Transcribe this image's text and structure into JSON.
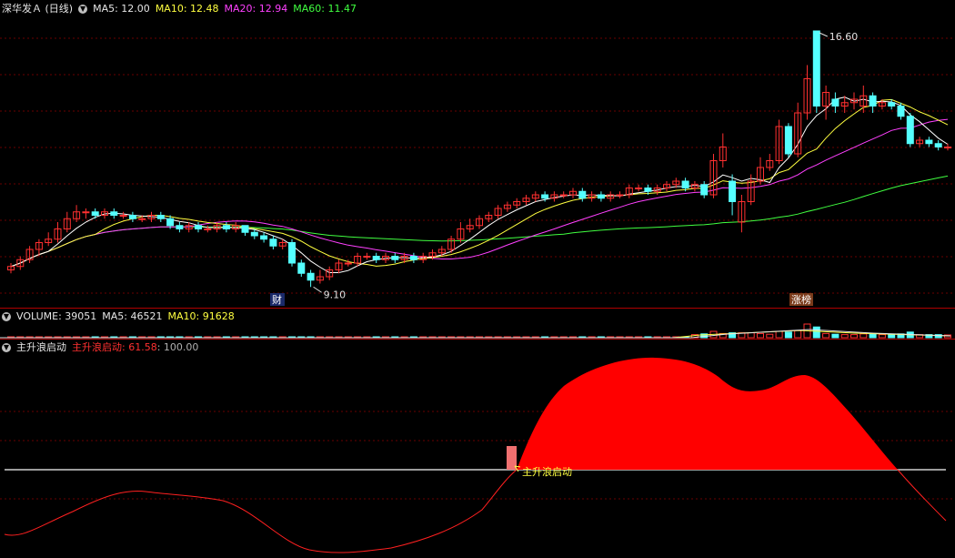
{
  "header": {
    "stock": "深华发Ａ (日线)",
    "ma5": "MA5: 12.00",
    "ma10": "MA10: 12.48",
    "ma20": "MA20: 12.94",
    "ma60": "MA60: 11.47"
  },
  "volume_header": {
    "title": "VOLUME: 39051",
    "ma5": "MA5: 46521",
    "ma10": "MA10: 91628"
  },
  "indicator_header": {
    "title": "主升浪启动",
    "value": "主升浪启动: 61.58",
    "level": ": 100.00"
  },
  "annotations": {
    "high": "16.60",
    "low": "9.10",
    "cai_badge": "财",
    "zhangbang_badge": "涨榜",
    "signal_label": "主升浪启动"
  },
  "colors": {
    "up": "#ff3030",
    "down": "#54ffff",
    "ma5": "#ffffff",
    "ma10": "#ffff40",
    "ma20": "#ff40ff",
    "ma60": "#40ff40",
    "indicator_fill": "#ff0000"
  },
  "chart_data": {
    "type": "candlestick",
    "candles": [
      {
        "o": 9.6,
        "c": 9.7,
        "h": 9.8,
        "l": 9.5
      },
      {
        "o": 9.7,
        "c": 9.9,
        "h": 10.0,
        "l": 9.6
      },
      {
        "o": 9.9,
        "c": 10.2,
        "h": 10.3,
        "l": 9.8
      },
      {
        "o": 10.2,
        "c": 10.4,
        "h": 10.5,
        "l": 10.0
      },
      {
        "o": 10.4,
        "c": 10.5,
        "h": 10.7,
        "l": 10.3
      },
      {
        "o": 10.5,
        "c": 10.8,
        "h": 11.0,
        "l": 10.4
      },
      {
        "o": 10.8,
        "c": 11.1,
        "h": 11.3,
        "l": 10.7
      },
      {
        "o": 11.1,
        "c": 11.3,
        "h": 11.5,
        "l": 11.0
      },
      {
        "o": 11.3,
        "c": 11.3,
        "h": 11.4,
        "l": 11.1
      },
      {
        "o": 11.3,
        "c": 11.2,
        "h": 11.4,
        "l": 11.1
      },
      {
        "o": 11.2,
        "c": 11.3,
        "h": 11.4,
        "l": 11.1
      },
      {
        "o": 11.3,
        "c": 11.2,
        "h": 11.4,
        "l": 11.1
      },
      {
        "o": 11.2,
        "c": 11.2,
        "h": 11.3,
        "l": 11.1
      },
      {
        "o": 11.2,
        "c": 11.1,
        "h": 11.3,
        "l": 11.0
      },
      {
        "o": 11.1,
        "c": 11.1,
        "h": 11.2,
        "l": 11.0
      },
      {
        "o": 11.1,
        "c": 11.2,
        "h": 11.3,
        "l": 11.0
      },
      {
        "o": 11.2,
        "c": 11.1,
        "h": 11.3,
        "l": 11.0
      },
      {
        "o": 11.1,
        "c": 10.9,
        "h": 11.2,
        "l": 10.8
      },
      {
        "o": 10.9,
        "c": 10.8,
        "h": 11.0,
        "l": 10.7
      },
      {
        "o": 10.8,
        "c": 10.9,
        "h": 11.0,
        "l": 10.7
      },
      {
        "o": 10.9,
        "c": 10.8,
        "h": 11.0,
        "l": 10.7
      },
      {
        "o": 10.8,
        "c": 10.8,
        "h": 10.9,
        "l": 10.7
      },
      {
        "o": 10.8,
        "c": 10.9,
        "h": 11.0,
        "l": 10.7
      },
      {
        "o": 10.9,
        "c": 10.8,
        "h": 11.0,
        "l": 10.7
      },
      {
        "o": 10.8,
        "c": 10.9,
        "h": 11.0,
        "l": 10.7
      },
      {
        "o": 10.9,
        "c": 10.7,
        "h": 10.9,
        "l": 10.6
      },
      {
        "o": 10.7,
        "c": 10.6,
        "h": 10.8,
        "l": 10.5
      },
      {
        "o": 10.6,
        "c": 10.5,
        "h": 10.7,
        "l": 10.4
      },
      {
        "o": 10.5,
        "c": 10.3,
        "h": 10.6,
        "l": 10.2
      },
      {
        "o": 10.3,
        "c": 10.4,
        "h": 10.5,
        "l": 10.2
      },
      {
        "o": 10.4,
        "c": 9.8,
        "h": 10.5,
        "l": 9.7
      },
      {
        "o": 9.8,
        "c": 9.5,
        "h": 9.9,
        "l": 9.4
      },
      {
        "o": 9.5,
        "c": 9.3,
        "h": 9.6,
        "l": 9.1
      },
      {
        "o": 9.3,
        "c": 9.4,
        "h": 9.6,
        "l": 9.2
      },
      {
        "o": 9.4,
        "c": 9.6,
        "h": 9.7,
        "l": 9.3
      },
      {
        "o": 9.6,
        "c": 9.8,
        "h": 9.9,
        "l": 9.5
      },
      {
        "o": 9.8,
        "c": 9.8,
        "h": 9.9,
        "l": 9.7
      },
      {
        "o": 9.8,
        "c": 10.0,
        "h": 10.1,
        "l": 9.7
      },
      {
        "o": 10.0,
        "c": 10.0,
        "h": 10.1,
        "l": 9.9
      },
      {
        "o": 10.0,
        "c": 9.9,
        "h": 10.1,
        "l": 9.8
      },
      {
        "o": 9.9,
        "c": 10.0,
        "h": 10.1,
        "l": 9.8
      },
      {
        "o": 10.0,
        "c": 9.9,
        "h": 10.1,
        "l": 9.8
      },
      {
        "o": 9.9,
        "c": 10.0,
        "h": 10.1,
        "l": 9.8
      },
      {
        "o": 10.0,
        "c": 9.9,
        "h": 10.1,
        "l": 9.8
      },
      {
        "o": 9.9,
        "c": 10.0,
        "h": 10.1,
        "l": 9.8
      },
      {
        "o": 10.0,
        "c": 10.1,
        "h": 10.2,
        "l": 9.9
      },
      {
        "o": 10.1,
        "c": 10.2,
        "h": 10.3,
        "l": 10.0
      },
      {
        "o": 10.2,
        "c": 10.5,
        "h": 10.6,
        "l": 10.1
      },
      {
        "o": 10.5,
        "c": 10.8,
        "h": 11.0,
        "l": 10.4
      },
      {
        "o": 10.8,
        "c": 10.9,
        "h": 11.1,
        "l": 10.7
      },
      {
        "o": 10.9,
        "c": 11.1,
        "h": 11.2,
        "l": 10.8
      },
      {
        "o": 11.1,
        "c": 11.2,
        "h": 11.3,
        "l": 11.0
      },
      {
        "o": 11.2,
        "c": 11.4,
        "h": 11.5,
        "l": 11.1
      },
      {
        "o": 11.4,
        "c": 11.5,
        "h": 11.6,
        "l": 11.3
      },
      {
        "o": 11.5,
        "c": 11.6,
        "h": 11.7,
        "l": 11.4
      },
      {
        "o": 11.6,
        "c": 11.7,
        "h": 11.8,
        "l": 11.5
      },
      {
        "o": 11.7,
        "c": 11.8,
        "h": 11.9,
        "l": 11.6
      },
      {
        "o": 11.8,
        "c": 11.7,
        "h": 11.9,
        "l": 11.6
      },
      {
        "o": 11.7,
        "c": 11.8,
        "h": 11.9,
        "l": 11.6
      },
      {
        "o": 11.8,
        "c": 11.8,
        "h": 11.9,
        "l": 11.7
      },
      {
        "o": 11.8,
        "c": 11.9,
        "h": 12.0,
        "l": 11.7
      },
      {
        "o": 11.9,
        "c": 11.7,
        "h": 12.0,
        "l": 11.6
      },
      {
        "o": 11.7,
        "c": 11.8,
        "h": 11.9,
        "l": 11.6
      },
      {
        "o": 11.8,
        "c": 11.7,
        "h": 11.9,
        "l": 11.6
      },
      {
        "o": 11.7,
        "c": 11.8,
        "h": 11.9,
        "l": 11.6
      },
      {
        "o": 11.8,
        "c": 11.8,
        "h": 11.9,
        "l": 11.7
      },
      {
        "o": 11.8,
        "c": 12.0,
        "h": 12.1,
        "l": 11.7
      },
      {
        "o": 12.0,
        "c": 12.0,
        "h": 12.1,
        "l": 11.9
      },
      {
        "o": 12.0,
        "c": 11.9,
        "h": 12.1,
        "l": 11.8
      },
      {
        "o": 11.9,
        "c": 12.0,
        "h": 12.1,
        "l": 11.8
      },
      {
        "o": 12.0,
        "c": 12.1,
        "h": 12.2,
        "l": 11.9
      },
      {
        "o": 12.1,
        "c": 12.2,
        "h": 12.3,
        "l": 12.0
      },
      {
        "o": 12.2,
        "c": 12.0,
        "h": 12.3,
        "l": 11.9
      },
      {
        "o": 12.0,
        "c": 12.1,
        "h": 12.2,
        "l": 11.9
      },
      {
        "o": 12.1,
        "c": 11.8,
        "h": 12.2,
        "l": 11.7
      },
      {
        "o": 11.8,
        "c": 12.8,
        "h": 13.0,
        "l": 11.7
      },
      {
        "o": 12.8,
        "c": 13.2,
        "h": 13.6,
        "l": 12.6
      },
      {
        "o": 12.2,
        "c": 11.6,
        "h": 12.4,
        "l": 11.2
      },
      {
        "o": 11.0,
        "c": 11.6,
        "h": 11.8,
        "l": 10.7
      },
      {
        "o": 11.6,
        "c": 12.2,
        "h": 12.4,
        "l": 11.5
      },
      {
        "o": 12.2,
        "c": 12.6,
        "h": 12.9,
        "l": 12.1
      },
      {
        "o": 12.6,
        "c": 12.8,
        "h": 13.0,
        "l": 12.5
      },
      {
        "o": 12.8,
        "c": 13.8,
        "h": 14.0,
        "l": 12.7
      },
      {
        "o": 13.8,
        "c": 13.0,
        "h": 13.9,
        "l": 12.9
      },
      {
        "o": 13.0,
        "c": 14.2,
        "h": 14.5,
        "l": 12.9
      },
      {
        "o": 14.2,
        "c": 15.2,
        "h": 15.6,
        "l": 14.0
      },
      {
        "o": 16.6,
        "c": 14.4,
        "h": 16.6,
        "l": 14.2
      },
      {
        "o": 14.4,
        "c": 14.8,
        "h": 15.0,
        "l": 14.0
      },
      {
        "o": 14.6,
        "c": 14.4,
        "h": 14.8,
        "l": 14.2
      },
      {
        "o": 14.4,
        "c": 14.5,
        "h": 14.7,
        "l": 14.2
      },
      {
        "o": 14.5,
        "c": 14.6,
        "h": 14.8,
        "l": 14.3
      },
      {
        "o": 14.4,
        "c": 14.7,
        "h": 15.0,
        "l": 14.2
      },
      {
        "o": 14.7,
        "c": 14.4,
        "h": 14.8,
        "l": 14.2
      },
      {
        "o": 14.4,
        "c": 14.5,
        "h": 14.6,
        "l": 14.3
      },
      {
        "o": 14.5,
        "c": 14.4,
        "h": 14.6,
        "l": 14.3
      },
      {
        "o": 14.4,
        "c": 14.1,
        "h": 14.5,
        "l": 14.0
      },
      {
        "o": 14.1,
        "c": 13.3,
        "h": 14.2,
        "l": 13.2
      },
      {
        "o": 13.3,
        "c": 13.4,
        "h": 13.5,
        "l": 13.2
      },
      {
        "o": 13.4,
        "c": 13.3,
        "h": 13.5,
        "l": 13.2
      },
      {
        "o": 13.3,
        "c": 13.2,
        "h": 13.4,
        "l": 13.1
      },
      {
        "o": 13.2,
        "c": 13.2,
        "h": 13.3,
        "l": 13.1
      }
    ],
    "ylim": [
      8.6,
      17.4
    ]
  }
}
